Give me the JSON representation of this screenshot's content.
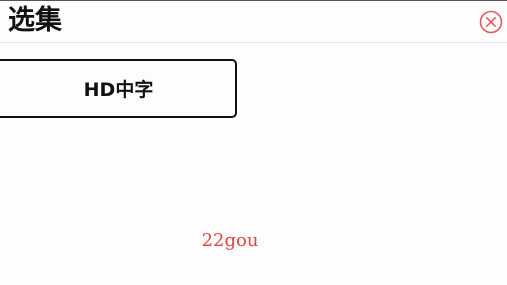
{
  "header": {
    "title": "选集",
    "close_icon": "close-circle-icon",
    "close_color": "#e35b5b"
  },
  "episodes": [
    {
      "label": "HD中字"
    }
  ],
  "watermark": {
    "text": "22gou",
    "color": "#d9473f"
  }
}
